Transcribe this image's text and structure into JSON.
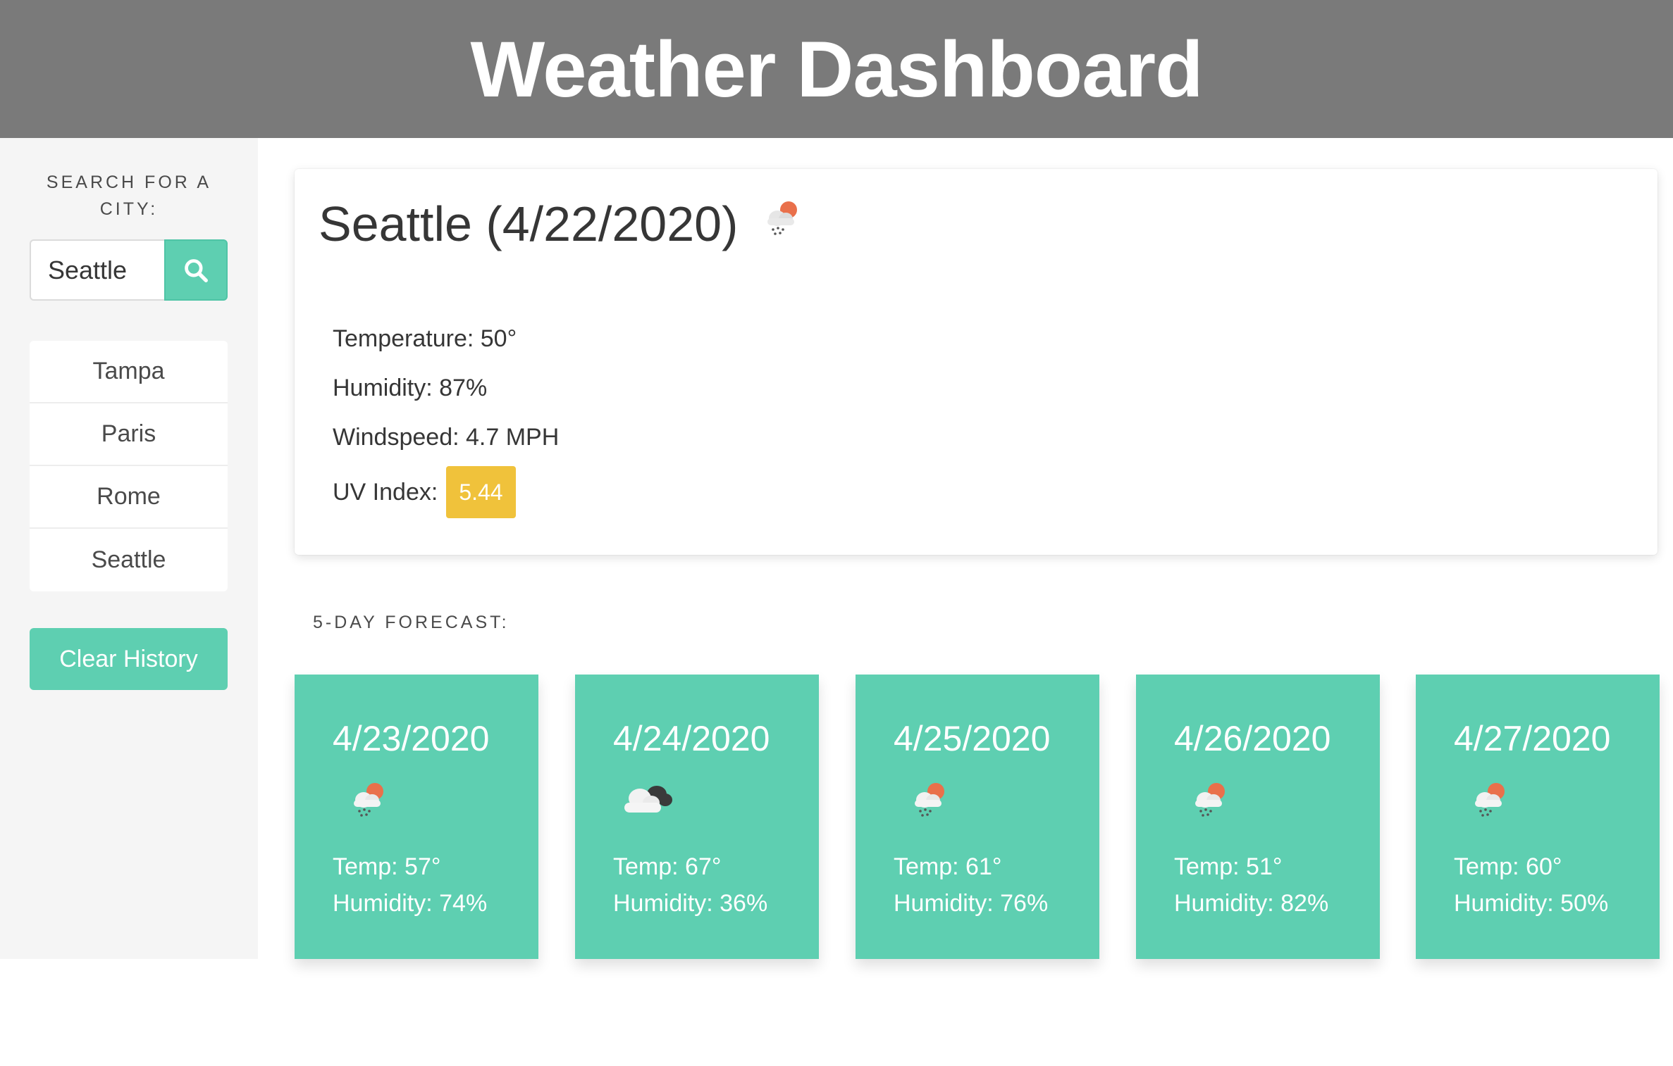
{
  "header": {
    "title": "Weather Dashboard"
  },
  "sidebar": {
    "search_label": "Search for a City:",
    "search_value": "Seattle",
    "search_button_icon": "search-icon",
    "history": [
      {
        "label": "Tampa"
      },
      {
        "label": "Paris"
      },
      {
        "label": "Rome"
      },
      {
        "label": "Seattle"
      }
    ],
    "clear_label": "Clear History"
  },
  "current": {
    "title": "Seattle (4/22/2020)",
    "icon": "rain-sun-cloud-icon",
    "temperature": "Temperature: 50°",
    "humidity": "Humidity: 87%",
    "windspeed": "Windspeed: 4.7 MPH",
    "uv_label": "UV Index:",
    "uv_value": "5.44",
    "uv_color": "#f0c23b"
  },
  "forecast": {
    "label": "5-Day Forecast:",
    "days": [
      {
        "date": "4/23/2020",
        "icon": "rain-sun-cloud-icon",
        "temp": "Temp: 57°",
        "humidity": "Humidity: 74%"
      },
      {
        "date": "4/24/2020",
        "icon": "cloudy-icon",
        "temp": "Temp: 67°",
        "humidity": "Humidity: 36%"
      },
      {
        "date": "4/25/2020",
        "icon": "rain-sun-cloud-icon",
        "temp": "Temp: 61°",
        "humidity": "Humidity: 76%"
      },
      {
        "date": "4/26/2020",
        "icon": "rain-sun-cloud-icon",
        "temp": "Temp: 51°",
        "humidity": "Humidity: 82%"
      },
      {
        "date": "4/27/2020",
        "icon": "rain-sun-cloud-icon",
        "temp": "Temp: 60°",
        "humidity": "Humidity: 50%"
      }
    ]
  },
  "colors": {
    "accent": "#5ecfb1",
    "header_bg": "#7a7a7a",
    "sidebar_bg": "#f5f5f5"
  }
}
